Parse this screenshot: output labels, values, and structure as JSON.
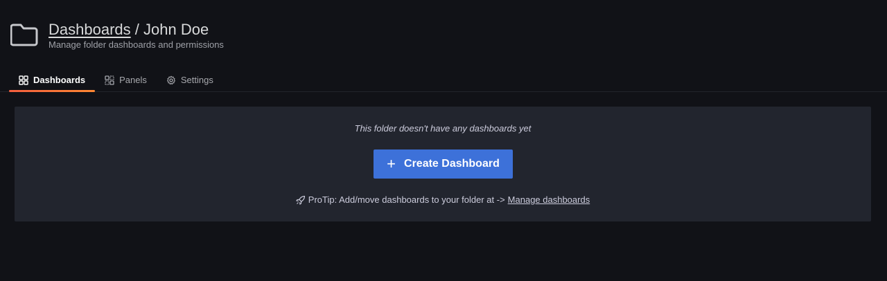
{
  "header": {
    "title_link": "Dashboards",
    "title_separator": "/",
    "title_name": "John Doe",
    "subtitle": "Manage folder dashboards and permissions"
  },
  "tabs": [
    {
      "label": "Dashboards",
      "icon": "apps-icon",
      "active": true
    },
    {
      "label": "Panels",
      "icon": "library-panel-icon",
      "active": false
    },
    {
      "label": "Settings",
      "icon": "cog-icon",
      "active": false
    }
  ],
  "empty_state": {
    "message": "This folder doesn't have any dashboards yet",
    "button_label": "Create Dashboard",
    "button_icon": "plus-icon",
    "protip_text": "ProTip: Add/move dashboards to your folder at ->",
    "protip_link": "Manage dashboards",
    "protip_icon": "rocket-icon"
  },
  "colors": {
    "background": "#111217",
    "panel": "#22252e",
    "primary_button": "#3d71d9",
    "active_tab_underline": "#f55f3e"
  }
}
